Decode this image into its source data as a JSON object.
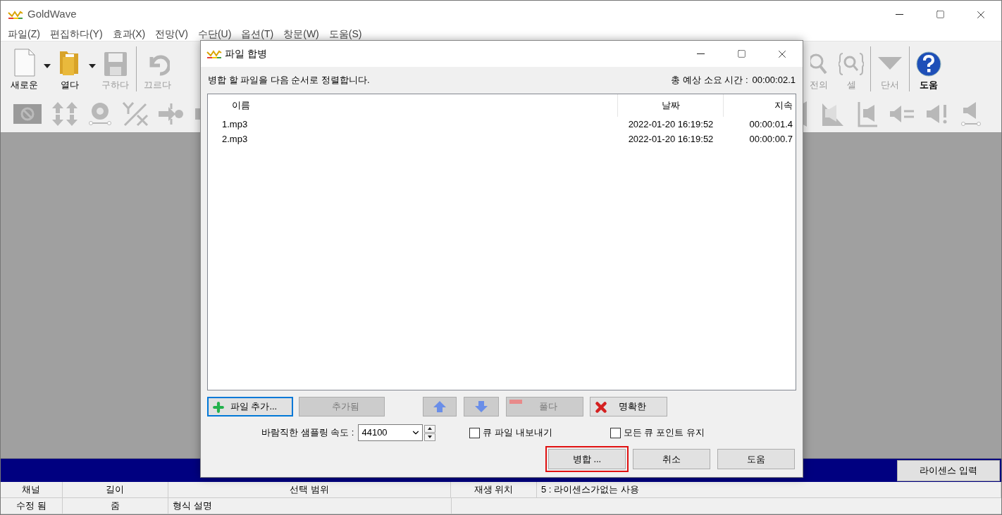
{
  "window": {
    "title": "GoldWave"
  },
  "menu": [
    "파일(Z)",
    "편집하다(Y)",
    "효과(X)",
    "전망(V)",
    "수단(U)",
    "옵션(T)",
    "창문(W)",
    "도움(S)"
  ],
  "toolbar_left": [
    {
      "kind": "new",
      "label": "새로운",
      "dropdown": true,
      "disabled": false
    },
    {
      "kind": "open",
      "label": "열다",
      "dropdown": true,
      "disabled": false
    },
    {
      "kind": "save",
      "label": "구하다",
      "dropdown": false,
      "disabled": true
    },
    {
      "kind": "undo",
      "label": "끄르다",
      "dropdown": false,
      "disabled": true
    }
  ],
  "toolbar_right": [
    {
      "kind": "zoom",
      "label": "전의",
      "dropdown": false,
      "disabled": true
    },
    {
      "kind": "select",
      "label": "셀",
      "dropdown": false,
      "disabled": true
    },
    {
      "kind": "cue",
      "label": "단서",
      "dropdown": false,
      "disabled": true
    },
    {
      "kind": "help",
      "label": "도움",
      "dropdown": false,
      "disabled": false
    }
  ],
  "license_button": "라이센스 입력",
  "status_bar": [
    [
      {
        "text": "채널",
        "kind": "label"
      },
      {
        "text": "길이",
        "kind": "label"
      },
      {
        "text": "선택 범위",
        "kind": "label"
      },
      {
        "text": "재생 위치",
        "kind": "label"
      },
      {
        "text": "5 : 라이센스가없는 사용",
        "kind": "value"
      }
    ],
    [
      {
        "text": "수정 됨",
        "kind": "label"
      },
      {
        "text": "줌",
        "kind": "label"
      },
      {
        "text": "형식 설명",
        "kind": "value"
      }
    ]
  ],
  "dialog": {
    "title": "파일 합병",
    "instruction": "병합 할 파일을 다음 순서로 정렬합니다.",
    "total_label": "총 예상 소요 시간 :",
    "total_time": "00:00:02.1",
    "columns": [
      "이름",
      "날짜",
      "지속"
    ],
    "rows": [
      {
        "name": "1.mp3",
        "date": "2022-01-20 16:19:52",
        "duration": "00:00:01.4"
      },
      {
        "name": "2.mp3",
        "date": "2022-01-20 16:19:52",
        "duration": "00:00:00.7"
      }
    ],
    "list_buttons": [
      {
        "kind": "add",
        "label": "파일 추가...",
        "disabled": false,
        "focused": true
      },
      {
        "kind": "plain",
        "label": "추가됨",
        "disabled": true,
        "focused": false
      },
      {
        "kind": "up",
        "disabled": true,
        "focused": false
      },
      {
        "kind": "down",
        "disabled": true,
        "focused": false
      },
      {
        "kind": "remove",
        "label": "풀다",
        "disabled": true,
        "focused": false
      },
      {
        "kind": "clear",
        "label": "명확한",
        "disabled": false,
        "focused": false
      }
    ],
    "sample_rate_label": "바람직한 샘플링 속도 :",
    "sample_rate": "44100",
    "checkboxes": [
      {
        "label": "큐 파일 내보내기",
        "checked": false
      },
      {
        "label": "모든 큐 포인트 유지",
        "checked": false
      }
    ],
    "action_buttons": [
      {
        "label": "병합 ...",
        "highlighted": true
      },
      {
        "label": "취소",
        "highlighted": false
      },
      {
        "label": "도움",
        "highlighted": false
      }
    ]
  }
}
